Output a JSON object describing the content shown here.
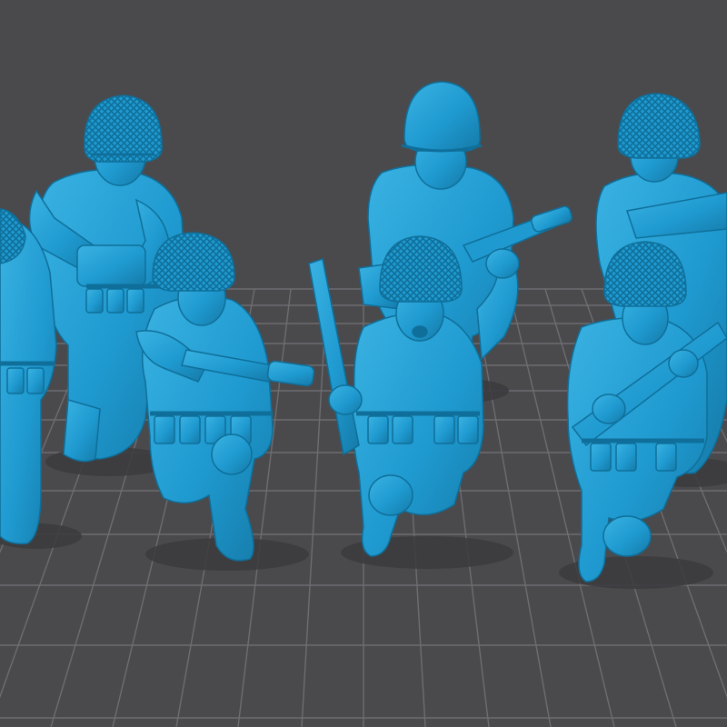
{
  "scene": {
    "background_color": "#4a4a4d",
    "grid_color": "#6d6d72",
    "model_color": "#1f9ad0",
    "model_shadow_color": "#157aa8",
    "model_highlight_color": "#55c3ec",
    "models": [
      {
        "pose": "standing",
        "helmet": "netted"
      },
      {
        "pose": "standing",
        "helmet": "plain"
      },
      {
        "pose": "standing",
        "helmet": "netted"
      },
      {
        "pose": "standing",
        "helmet": "netted"
      },
      {
        "pose": "kneeling",
        "helmet": "netted"
      },
      {
        "pose": "kneeling",
        "helmet": "netted"
      },
      {
        "pose": "kneeling",
        "helmet": "netted"
      }
    ]
  }
}
